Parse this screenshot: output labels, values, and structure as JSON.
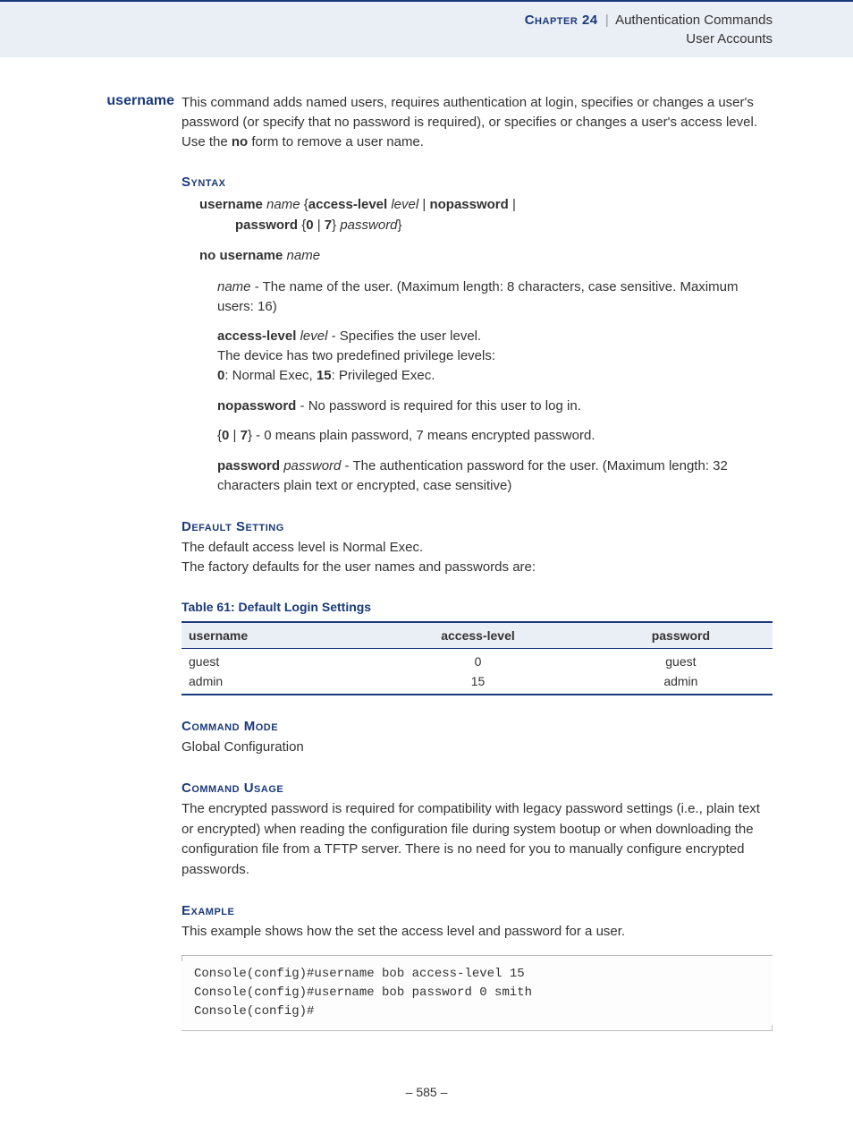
{
  "header": {
    "chapter_label": "Chapter 24",
    "bar": "|",
    "chapter_title": "Authentication Commands",
    "subtitle": "User Accounts"
  },
  "command": {
    "name": "username",
    "description_pre": "This command adds named users, requires authentication at login, specifies or changes a user's password (or specify that no password is required), or specifies or changes a user's access level. Use the ",
    "description_bold": "no",
    "description_post": " form to remove a user name."
  },
  "syntax": {
    "heading": "Syntax",
    "line1": {
      "p1": "username ",
      "i1": "name ",
      "p2": "{",
      "b1": "access-level ",
      "i2": "level ",
      "p3": "| ",
      "b2": "nopassword ",
      "p4": "|"
    },
    "line2": {
      "b1": "password ",
      "p1": "{",
      "b2": "0 ",
      "p2": "| ",
      "b3": "7",
      "p3": "} ",
      "i1": "password",
      "p4": "}"
    },
    "no_line": {
      "b1": "no username ",
      "i1": "name"
    },
    "params": {
      "name": {
        "i1": "name",
        "t1": " - The name of the user. (Maximum length: 8 characters, case sensitive. Maximum users: 16)"
      },
      "access": {
        "b1": "access-level ",
        "i1": "level",
        "t1": " - Specifies the user level.",
        "t2": "The device has two predefined privilege levels:",
        "b2": "0",
        "t3": ": Normal Exec, ",
        "b3": "15",
        "t4": ": Privileged Exec."
      },
      "nopassword": {
        "b1": "nopassword",
        "t1": " - No password is required for this user to log in."
      },
      "zero7": {
        "p1": "{",
        "b1": "0 ",
        "p2": "| ",
        "b2": "7",
        "p3": "} - 0 means plain password, 7 means encrypted password."
      },
      "password": {
        "b1": "password ",
        "i1": "password",
        "t1": " - The authentication password for the user. (Maximum length: 32 characters plain text or encrypted, case sensitive)"
      }
    }
  },
  "default_setting": {
    "heading": "Default Setting",
    "line1": "The default access level is Normal Exec.",
    "line2": "The factory defaults for the user names and passwords are:"
  },
  "chart_data": {
    "type": "table",
    "caption": "Table 61: Default Login Settings",
    "columns": [
      "username",
      "access-level",
      "password"
    ],
    "rows": [
      {
        "username": "guest",
        "access_level": "0",
        "password": "guest"
      },
      {
        "username": "admin",
        "access_level": "15",
        "password": "admin"
      }
    ]
  },
  "command_mode": {
    "heading": "Command Mode",
    "text": "Global Configuration"
  },
  "command_usage": {
    "heading": "Command Usage",
    "text": "The encrypted password is required for compatibility with legacy password settings (i.e., plain text or encrypted) when reading the configuration file during system bootup or when downloading the configuration file from a TFTP server. There is no need for you to manually configure encrypted passwords."
  },
  "example": {
    "heading": "Example",
    "intro": "This example shows how the set the access level and password for a user.",
    "lines": [
      "Console(config)#username bob access-level 15",
      "Console(config)#username bob password 0 smith",
      "Console(config)#"
    ]
  },
  "page_number": "– 585 –"
}
